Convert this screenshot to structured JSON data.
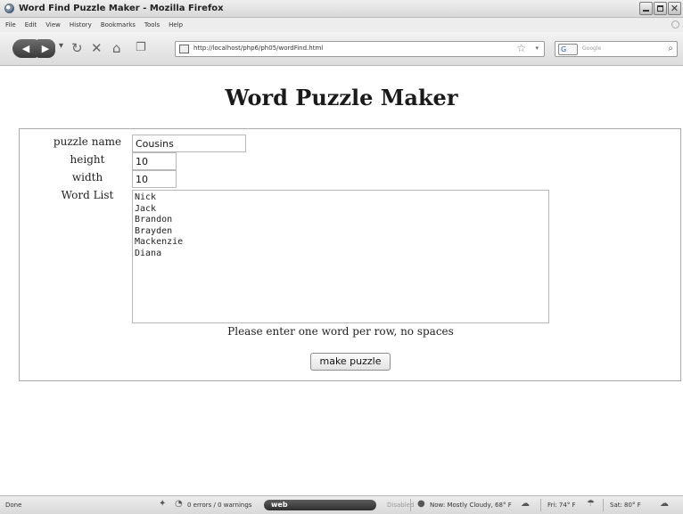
{
  "window": {
    "title": "Word Find Puzzle Maker - Mozilla Firefox"
  },
  "menubar": {
    "items": [
      "File",
      "Edit",
      "View",
      "History",
      "Bookmarks",
      "Tools",
      "Help"
    ]
  },
  "navbar": {
    "url": "http://localhost/php6/ph05/wordFind.html",
    "search_placeholder": "Google",
    "search_engine": "G"
  },
  "page": {
    "heading": "Word Puzzle Maker",
    "form": {
      "puzzle_name_label": "puzzle name",
      "puzzle_name_value": "Cousins",
      "height_label": "height",
      "height_value": "10",
      "width_label": "width",
      "width_value": "10",
      "word_list_label": "Word List",
      "words": [
        "Nick",
        "Jack",
        "Brandon",
        "Brayden",
        "Mackenzie",
        "Diana"
      ],
      "hint": "Please enter one word per row, no spaces",
      "submit_label": "make puzzle"
    }
  },
  "statusbar": {
    "state": "Done",
    "errors": "0 errors / 0 warnings",
    "addon": "web",
    "addon_state": "Disabled",
    "weather_now": "Now: Mostly Cloudy, 68° F",
    "weather_fri": "Fri: 74° F",
    "weather_sat": "Sat: 80° F"
  }
}
